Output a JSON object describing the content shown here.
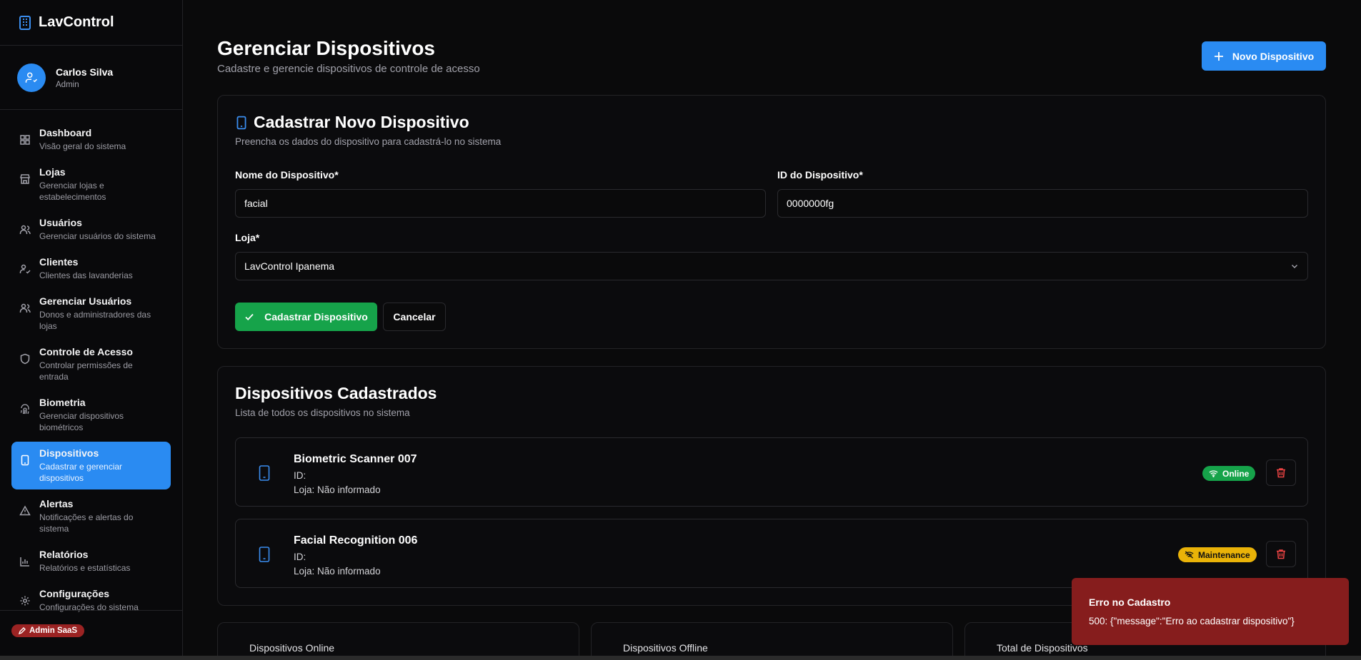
{
  "app": {
    "name": "LavControl",
    "logo_icon": "building-icon"
  },
  "user": {
    "name": "Carlos Silva",
    "role": "Admin"
  },
  "sidebar": {
    "items": [
      {
        "title": "Dashboard",
        "subtitle": "Visão geral do sistema",
        "icon": "dashboard-icon"
      },
      {
        "title": "Lojas",
        "subtitle": "Gerenciar lojas e estabelecimentos",
        "icon": "store-icon"
      },
      {
        "title": "Usuários",
        "subtitle": "Gerenciar usuários do sistema",
        "icon": "users-icon"
      },
      {
        "title": "Clientes",
        "subtitle": "Clientes das lavanderias",
        "icon": "user-check-icon"
      },
      {
        "title": "Gerenciar Usuários",
        "subtitle": "Donos e administradores das lojas",
        "icon": "users-icon"
      },
      {
        "title": "Controle de Acesso",
        "subtitle": "Controlar permissões de entrada",
        "icon": "shield-icon"
      },
      {
        "title": "Biometria",
        "subtitle": "Gerenciar dispositivos biométricos",
        "icon": "fingerprint-icon"
      },
      {
        "title": "Dispositivos",
        "subtitle": "Cadastrar e gerenciar dispositivos",
        "icon": "tablet-icon",
        "active": true
      },
      {
        "title": "Alertas",
        "subtitle": "Notificações e alertas do sistema",
        "icon": "alert-triangle-icon"
      },
      {
        "title": "Relatórios",
        "subtitle": "Relatórios e estatísticas",
        "icon": "bar-chart-icon"
      },
      {
        "title": "Configurações",
        "subtitle": "Configurações do sistema",
        "icon": "gear-icon"
      }
    ],
    "footer_badge": "Admin SaaS"
  },
  "page": {
    "title": "Gerenciar Dispositivos",
    "subtitle": "Cadastre e gerencie dispositivos de controle de acesso",
    "new_button": "Novo Dispositivo"
  },
  "form": {
    "title": "Cadastrar Novo Dispositivo",
    "subtitle": "Preencha os dados do dispositivo para cadastrá-lo no sistema",
    "name_label": "Nome do Dispositivo*",
    "name_value": "facial",
    "id_label": "ID do Dispositivo*",
    "id_value": "0000000fg",
    "store_label": "Loja*",
    "store_value": "LavControl Ipanema",
    "submit_label": "Cadastrar Dispositivo",
    "cancel_label": "Cancelar"
  },
  "list": {
    "title": "Dispositivos Cadastrados",
    "subtitle": "Lista de todos os dispositivos no sistema",
    "devices": [
      {
        "name": "Biometric Scanner 007",
        "id_text": "ID:",
        "store_text": "Loja: Não informado",
        "status": "Online",
        "status_color": "#16a34a"
      },
      {
        "name": "Facial Recognition 006",
        "id_text": "ID:",
        "store_text": "Loja: Não informado",
        "status": "Maintenance",
        "status_color": "#eab308"
      }
    ]
  },
  "stats": {
    "online": "Dispositivos Online",
    "offline": "Dispositivos Offline",
    "total": "Total de Dispositivos"
  },
  "toast": {
    "title": "Erro no Cadastro",
    "message": "500: {\"message\":\"Erro ao cadastrar dispositivo\"}"
  },
  "colors": {
    "accent": "#2a8bf2",
    "success": "#16a34a",
    "warning": "#eab308",
    "danger": "#861d1d"
  }
}
